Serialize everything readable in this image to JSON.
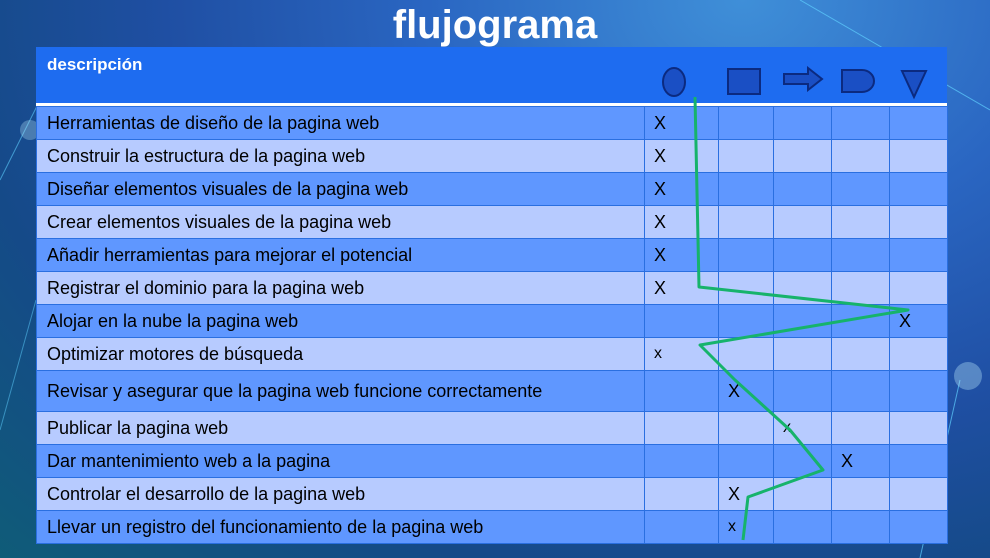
{
  "title": "flujograma",
  "header": {
    "description_label": "descripción",
    "symbols": [
      "oval-icon",
      "rectangle-icon",
      "arrow-icon",
      "delay-icon",
      "triangle-icon"
    ]
  },
  "rows": [
    {
      "label": "Herramientas de diseño de la pagina web",
      "marks": [
        "X",
        "",
        "",
        "",
        ""
      ]
    },
    {
      "label": "Construir la estructura de la pagina web",
      "marks": [
        "X",
        "",
        "",
        "",
        ""
      ]
    },
    {
      "label": "Diseñar elementos visuales de la pagina web",
      "marks": [
        "X",
        "",
        "",
        "",
        ""
      ]
    },
    {
      "label": "Crear elementos visuales de la pagina web",
      "marks": [
        "X",
        "",
        "",
        "",
        ""
      ]
    },
    {
      "label": "Añadir herramientas para mejorar el potencial",
      "marks": [
        "X",
        "",
        "",
        "",
        ""
      ]
    },
    {
      "label": "Registrar el dominio para la pagina web",
      "marks": [
        "X",
        "",
        "",
        "",
        ""
      ]
    },
    {
      "label": "Alojar en la nube la pagina web",
      "marks": [
        "",
        "",
        "",
        "",
        "X"
      ]
    },
    {
      "label": "Optimizar motores de búsqueda",
      "marks": [
        "x",
        "",
        "",
        "",
        ""
      ]
    },
    {
      "label": "Revisar y asegurar que la pagina web funcione correctamente",
      "marks": [
        "",
        "X",
        "",
        "",
        ""
      ]
    },
    {
      "label": "Publicar la pagina web",
      "marks": [
        "",
        "",
        "x",
        "",
        ""
      ]
    },
    {
      "label": "Dar mantenimiento web a la pagina",
      "marks": [
        "",
        "",
        "",
        "X",
        ""
      ]
    },
    {
      "label": "Controlar el desarrollo de la pagina web",
      "marks": [
        "",
        "X",
        "",
        "",
        ""
      ]
    },
    {
      "label": "Llevar un registro del funcionamiento de la pagina web",
      "marks": [
        "",
        "x",
        "",
        "",
        ""
      ]
    }
  ],
  "colors": {
    "header": "#1e6cf0",
    "row_dark": "#5f97ff",
    "row_light": "#b7cbff",
    "flow_line": "#16b36b",
    "symbol_fill": "#1a4fc4",
    "symbol_stroke": "#0b2a80"
  }
}
